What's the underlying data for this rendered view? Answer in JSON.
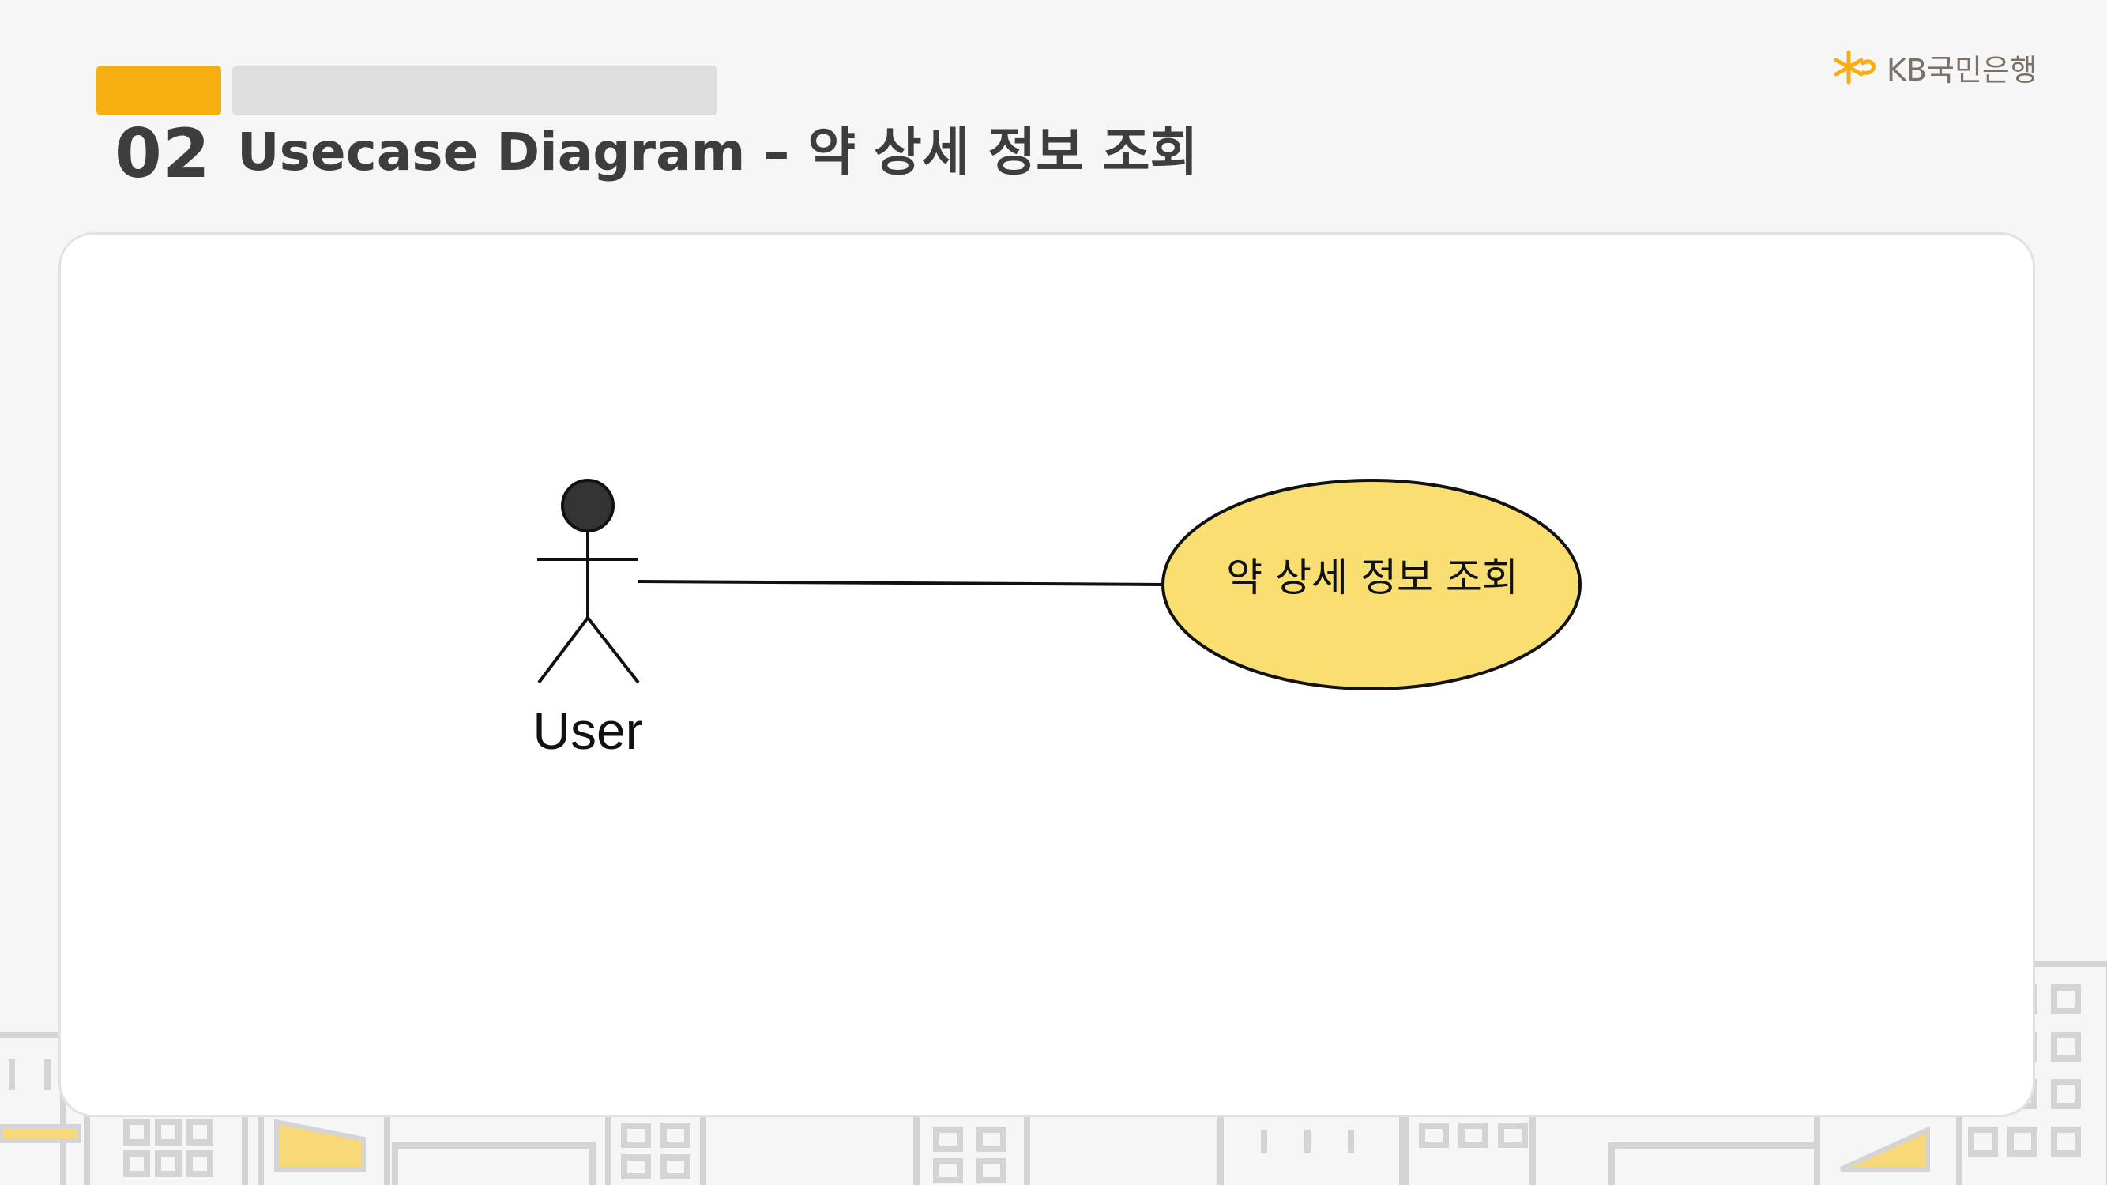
{
  "header": {
    "section_number": "02",
    "title": "Usecase Diagram – 약 상세 정보 조회"
  },
  "logo": {
    "text": "KB국민은행",
    "brand_color": "#f7ae10"
  },
  "diagram": {
    "actor": {
      "label": "User"
    },
    "usecase": {
      "label": "약 상세 정보 조회",
      "fill": "#f9df72"
    }
  },
  "colors": {
    "accent": "#f7ae10",
    "title": "#3d3d3d",
    "background": "#f6f6f6"
  }
}
